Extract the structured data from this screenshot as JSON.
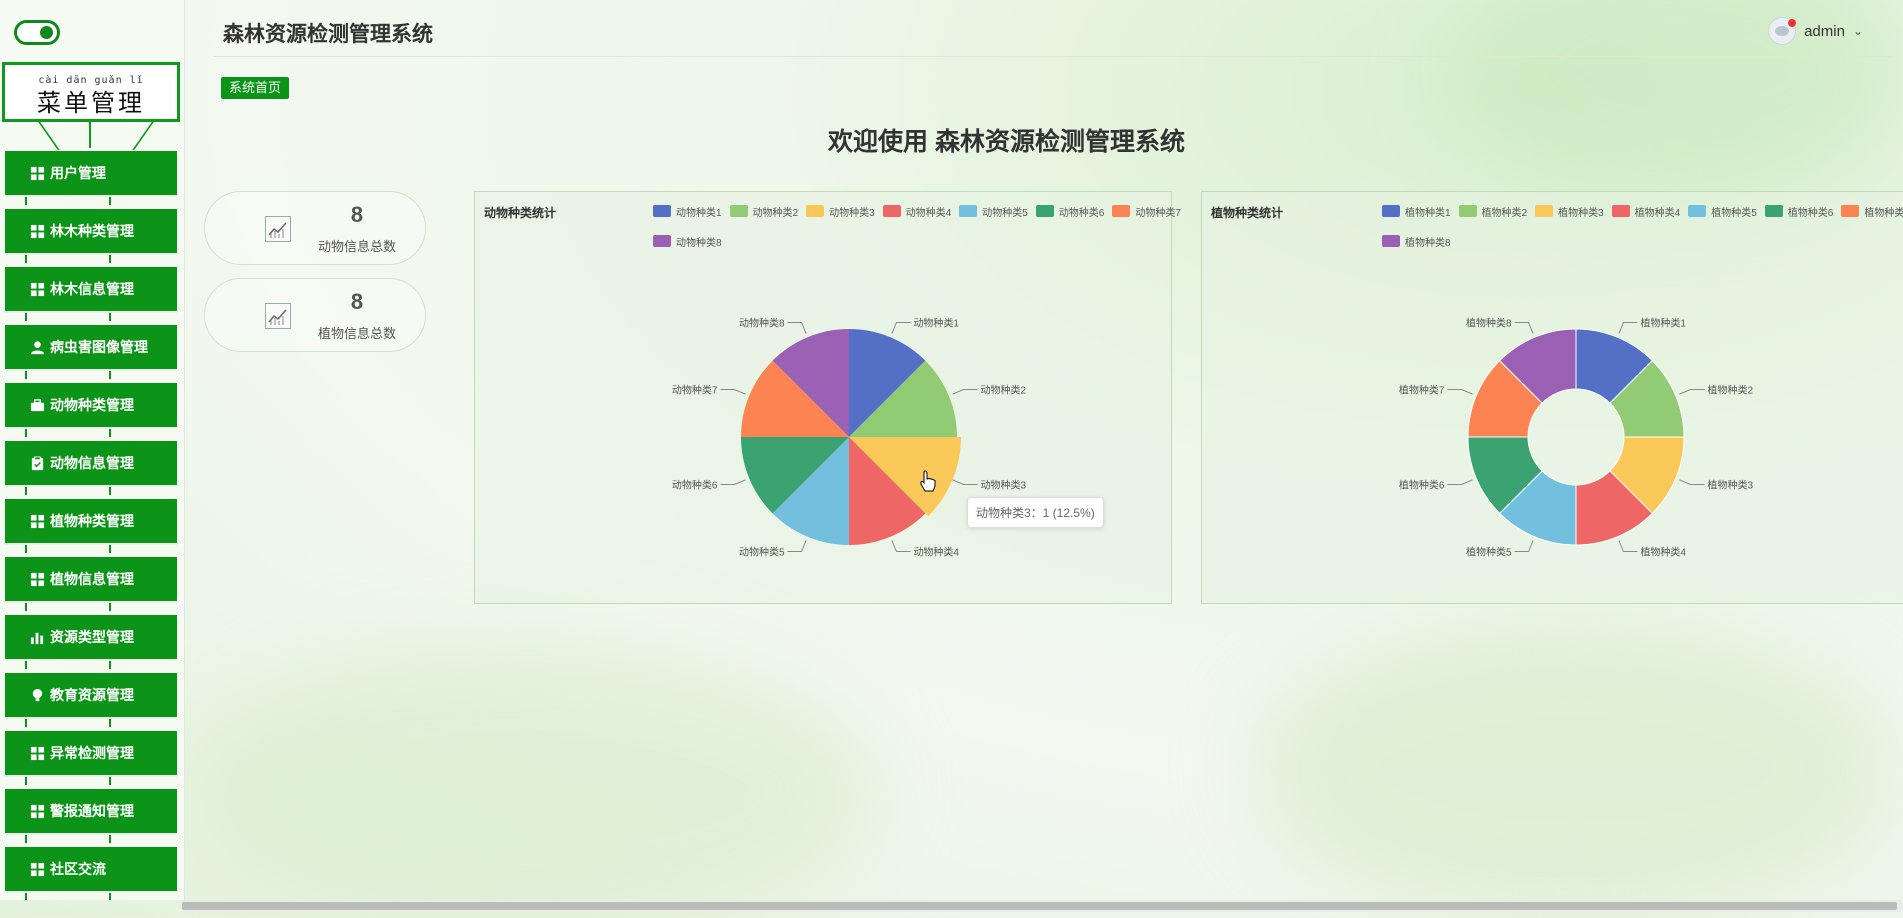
{
  "app_title": "森林资源检测管理系统",
  "sidebar": {
    "menu_title": "菜单管理",
    "menu_pinyin": "cài dān guǎn lǐ",
    "items": [
      {
        "label": "用户管理",
        "icon": "grid-icon"
      },
      {
        "label": "林木种类管理",
        "icon": "grid-icon"
      },
      {
        "label": "林木信息管理",
        "icon": "grid-icon"
      },
      {
        "label": "病虫害图像管理",
        "icon": "user-icon"
      },
      {
        "label": "动物种类管理",
        "icon": "briefcase-icon"
      },
      {
        "label": "动物信息管理",
        "icon": "clipboard-icon"
      },
      {
        "label": "植物种类管理",
        "icon": "grid-icon"
      },
      {
        "label": "植物信息管理",
        "icon": "grid-icon"
      },
      {
        "label": "资源类型管理",
        "icon": "bar-chart-icon"
      },
      {
        "label": "教育资源管理",
        "icon": "bulb-icon"
      },
      {
        "label": "异常检测管理",
        "icon": "grid-icon"
      },
      {
        "label": "警报通知管理",
        "icon": "grid-icon"
      },
      {
        "label": "社区交流",
        "icon": "grid-icon"
      }
    ]
  },
  "header": {
    "user": "admin"
  },
  "breadcrumb": "系统首页",
  "welcome": "欢迎使用 森林资源检测管理系统",
  "stats": [
    {
      "value": "8",
      "label": "动物信息总数",
      "icon": "line-chart-icon"
    },
    {
      "value": "8",
      "label": "植物信息总数",
      "icon": "line-chart-icon"
    }
  ],
  "colors": [
    "#5470c6",
    "#91cc75",
    "#fac858",
    "#ee6666",
    "#73c0de",
    "#3ba272",
    "#fc8452",
    "#9a60b4"
  ],
  "chart_data": [
    {
      "type": "pie",
      "title": "动物种类统计",
      "categories": [
        "动物种类1",
        "动物种类2",
        "动物种类3",
        "动物种类4",
        "动物种类5",
        "动物种类6",
        "动物种类7",
        "动物种类8"
      ],
      "values": [
        1,
        1,
        1,
        1,
        1,
        1,
        1,
        1
      ],
      "legend": "top"
    },
    {
      "type": "pie",
      "donut": true,
      "title": "植物种类统计",
      "categories": [
        "植物种类1",
        "植物种类2",
        "植物种类3",
        "植物种类4",
        "植物种类5",
        "植物种类6",
        "植物种类7",
        "植物种类8"
      ],
      "values": [
        1,
        1,
        1,
        1,
        1,
        1,
        1,
        1
      ],
      "legend": "top"
    }
  ],
  "tooltip": "动物种类3：1 (12.5%)"
}
